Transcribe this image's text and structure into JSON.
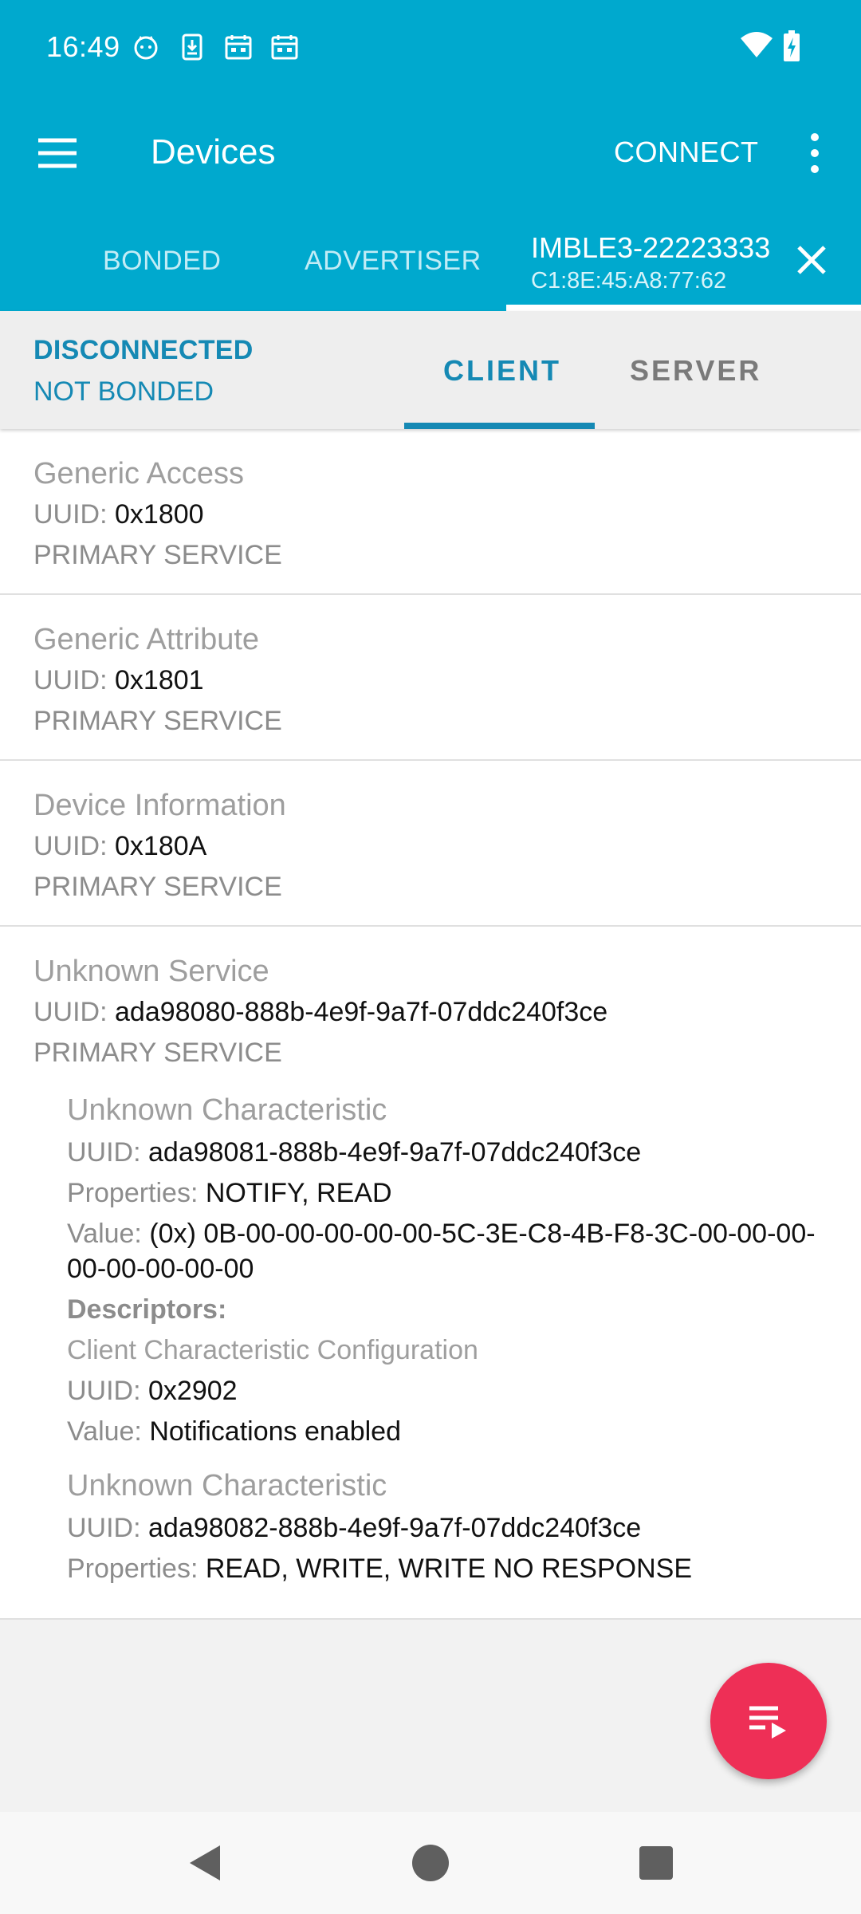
{
  "status_bar": {
    "time": "16:49",
    "icons": [
      "cat-face-icon",
      "download-icon",
      "calendar-icon",
      "calendar-icon",
      "wifi-icon",
      "battery-charging-icon"
    ]
  },
  "toolbar": {
    "title": "Devices",
    "connect_label": "CONNECT",
    "menu_icon": "hamburger-menu-icon",
    "more_icon": "more-vert-icon"
  },
  "top_tabs": {
    "bonded": "BONDED",
    "advertiser": "ADVERTISER",
    "device_name": "IMBLE3-22223333",
    "device_address": "C1:8E:45:A8:77:62"
  },
  "connection": {
    "state": "DISCONNECTED",
    "bond": "NOT BONDED"
  },
  "sub_tabs": {
    "client": "CLIENT",
    "server": "SERVER"
  },
  "labels": {
    "uuid": "UUID:",
    "properties": "Properties:",
    "value": "Value:",
    "descriptors": "Descriptors:"
  },
  "services": [
    {
      "name": "Generic Access",
      "uuid": "0x1800",
      "type": "PRIMARY SERVICE"
    },
    {
      "name": "Generic Attribute",
      "uuid": "0x1801",
      "type": "PRIMARY SERVICE"
    },
    {
      "name": "Device Information",
      "uuid": "0x180A",
      "type": "PRIMARY SERVICE"
    },
    {
      "name": "Unknown Service",
      "uuid": "ada98080-888b-4e9f-9a7f-07ddc240f3ce",
      "type": "PRIMARY SERVICE",
      "characteristics": [
        {
          "name": "Unknown Characteristic",
          "uuid": "ada98081-888b-4e9f-9a7f-07ddc240f3ce",
          "properties": "NOTIFY, READ",
          "value": "(0x) 0B-00-00-00-00-00-5C-3E-C8-4B-F8-3C-00-00-00-00-00-00-00-00",
          "descriptor": {
            "name": "Client Characteristic Configuration",
            "uuid": "0x2902",
            "value": "Notifications enabled"
          }
        },
        {
          "name": "Unknown Characteristic",
          "uuid": "ada98082-888b-4e9f-9a7f-07ddc240f3ce",
          "properties": "READ, WRITE, WRITE NO RESPONSE"
        }
      ]
    }
  ],
  "fab": {
    "icon": "log-playlist-icon"
  },
  "nav": {
    "icons": [
      "back-icon",
      "home-icon",
      "recents-icon"
    ]
  }
}
